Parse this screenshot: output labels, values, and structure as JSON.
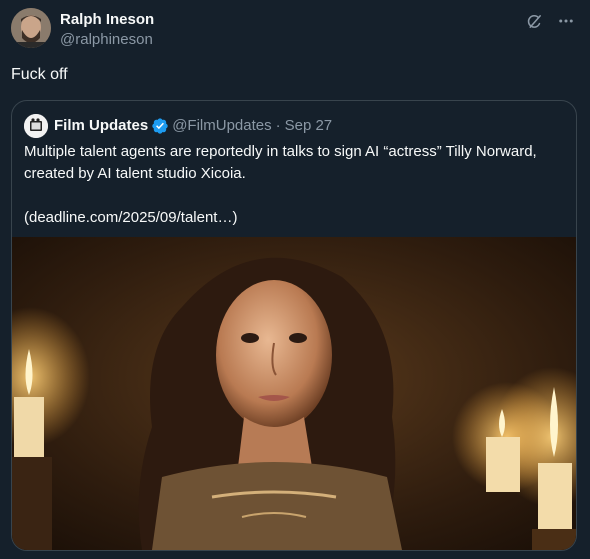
{
  "author": {
    "display_name": "Ralph Ineson",
    "handle": "@ralphineson",
    "avatar_icon": "profile-photo"
  },
  "tweet": {
    "text": "Fuck off"
  },
  "top_icons": [
    "grok-icon",
    "more-icon"
  ],
  "quote": {
    "display_name": "Film Updates",
    "handle": "@FilmUpdates",
    "separator": "·",
    "date": "Sep 27",
    "verified_icon": "verified-badge-icon",
    "verified_color": "#1d9bf0",
    "text_line": "Multiple talent agents are reportedly in talks to sign AI “actress” Tilly Norward, created by AI talent studio Xicoia.",
    "link": "(deadline.com/2025/09/talent…)",
    "media_icon": "candlelit-portrait-image"
  },
  "colors": {
    "background": "#15202b",
    "text": "#f7f9f9",
    "muted": "#8b98a5",
    "border": "#38444d"
  }
}
